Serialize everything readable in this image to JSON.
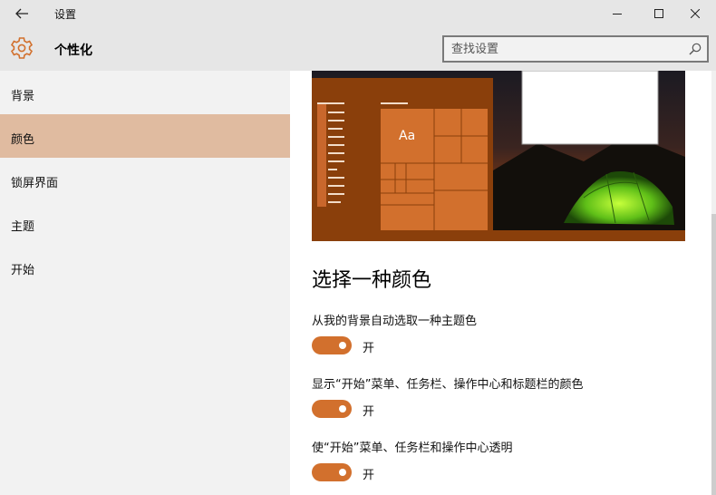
{
  "window": {
    "title": "设置",
    "back_icon": "arrow-left-icon",
    "minimize_icon": "minimize-icon",
    "maximize_icon": "maximize-icon",
    "close_icon": "close-icon"
  },
  "header": {
    "title": "个性化",
    "icon": "gear-icon",
    "search": {
      "placeholder": "查找设置",
      "value": "",
      "icon": "search-icon"
    }
  },
  "sidebar": {
    "items": [
      {
        "label": "背景"
      },
      {
        "label": "颜色"
      },
      {
        "label": "锁屏界面"
      },
      {
        "label": "主题"
      },
      {
        "label": "开始"
      }
    ],
    "active_item": "颜色"
  },
  "main": {
    "preview": {
      "tile_sample_text": "Aa"
    },
    "section_title": "选择一种颜色",
    "settings": [
      {
        "label": "从我的背景自动选取一种主题色",
        "toggle_on": true,
        "state_text": "开"
      },
      {
        "label": "显示“开始”菜单、任务栏、操作中心和标题栏的颜色",
        "toggle_on": true,
        "state_text": "开"
      },
      {
        "label": "使“开始”菜单、任务栏和操作中心透明",
        "toggle_on": true,
        "state_text": "开"
      }
    ]
  },
  "colors": {
    "accent": "#d2702d",
    "active_nav": "#e0bba0",
    "chrome": "#e6e6e6",
    "sidebar": "#f2f2f2"
  }
}
